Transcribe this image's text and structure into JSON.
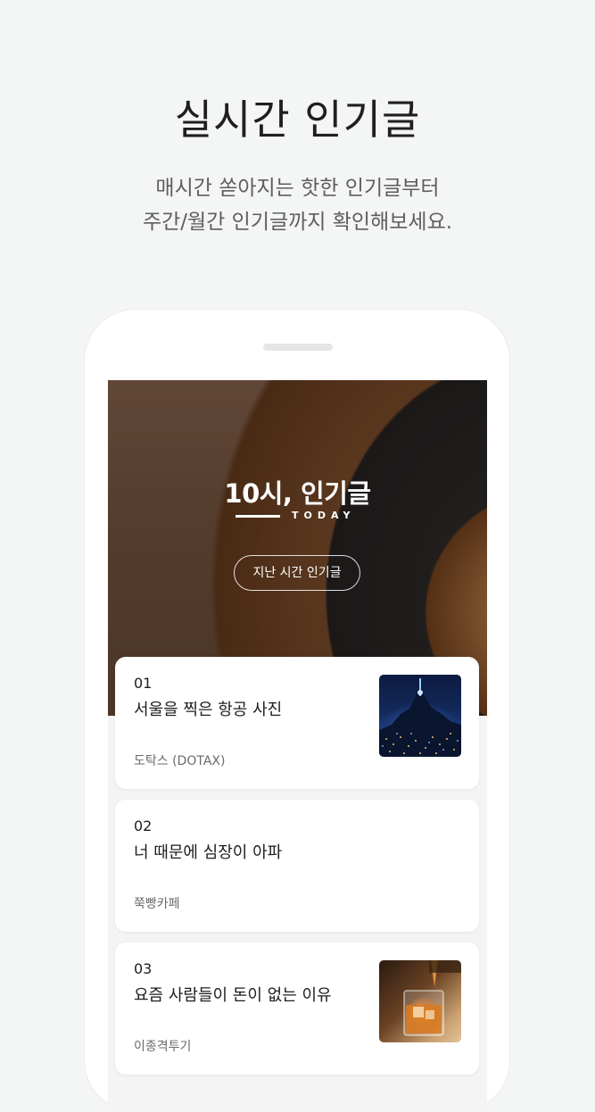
{
  "headline": "실시간 인기글",
  "subline": {
    "line1": "매시간 쏟아지는 핫한 인기글부터",
    "line2": "주간/월간 인기글까지 확인해보세요."
  },
  "hero": {
    "title": "10시, 인기글",
    "today_label": "TODAY",
    "past_button": "지난 시간 인기글"
  },
  "posts": [
    {
      "rank": "01",
      "title": "서울을 찍은 항공 사진",
      "author": "도탁스 (DOTAX)",
      "thumbnail": "night-city-photo"
    },
    {
      "rank": "02",
      "title": "너 때문에 심장이 아파",
      "author": "쭉빵카페",
      "thumbnail": null
    },
    {
      "rank": "03",
      "title": "요즘 사람들이 돈이 없는 이유",
      "author": "이종격투기",
      "thumbnail": "whiskey-drink-photo"
    }
  ]
}
